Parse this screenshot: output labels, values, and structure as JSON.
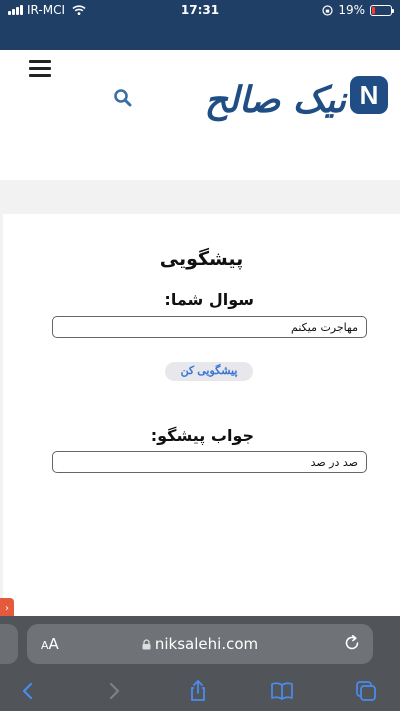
{
  "status_bar": {
    "carrier": "IR-MCI",
    "time": "17:31",
    "battery": "19%",
    "battery_level": 0.19
  },
  "header": {
    "logo_text": "نیک صالح",
    "logo_mark": "N"
  },
  "prediction": {
    "title": "پیشگویی",
    "question_label": "سوال شما:",
    "question_value": "مهاجرت میکنم",
    "button_label": "پیشگویی کن",
    "answer_label": "جواب پیشگو:",
    "answer_value": "صد در صد"
  },
  "browser": {
    "aa_label": "AA",
    "url": "niksalehi.com"
  },
  "colors": {
    "status_bar": "#1f3f66",
    "brand": "#1f4d84",
    "button_text": "#3a74d6",
    "browser_bar": "#515458"
  }
}
